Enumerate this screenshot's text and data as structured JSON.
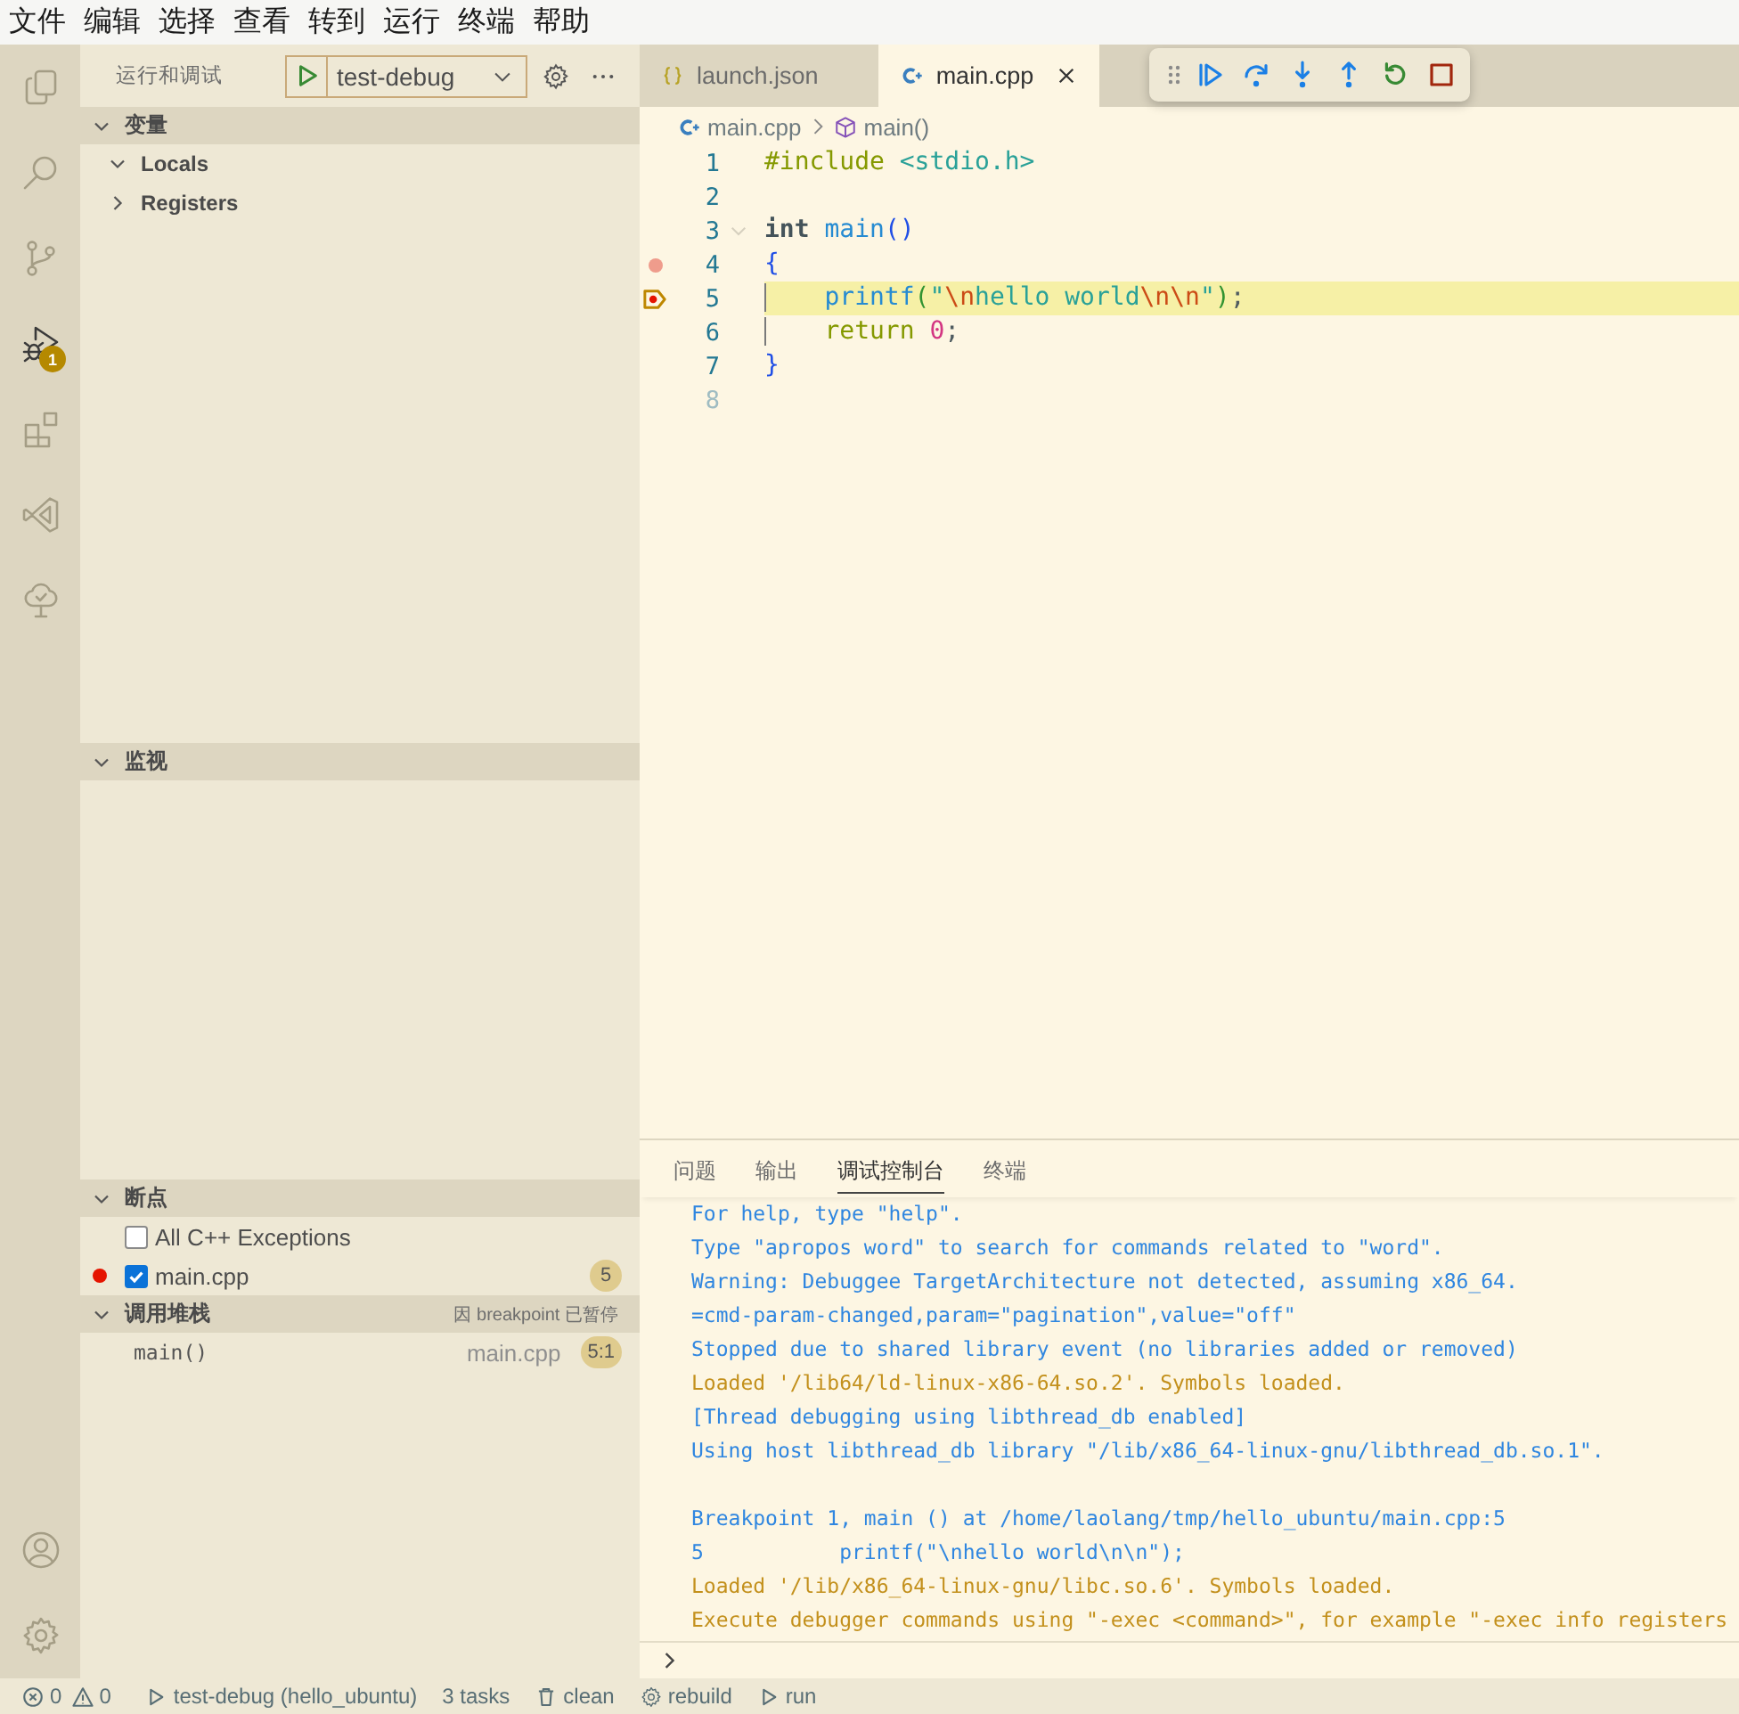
{
  "menu_bar": {
    "items": [
      "文件",
      "编辑",
      "选择",
      "查看",
      "转到",
      "运行",
      "终端",
      "帮助"
    ]
  },
  "activity_bar": {
    "items": [
      {
        "selected": false
      },
      {
        "selected": false
      },
      {
        "selected": false
      },
      {
        "selected": true,
        "badge": "1"
      },
      {
        "selected": false
      },
      {
        "selected": false
      },
      {
        "selected": false
      }
    ]
  },
  "sidebar": {
    "title": "运行和调试",
    "configuration": "test-debug",
    "variables": {
      "title": "变量",
      "expanded": true,
      "items": [
        {
          "label": "Locals",
          "expanded": true
        },
        {
          "label": "Registers",
          "expanded": false
        }
      ]
    },
    "watch": {
      "title": "监视",
      "expanded": true
    },
    "breakpoints": {
      "title": "断点",
      "expanded": true,
      "items": [
        {
          "kind": "exception",
          "label": "All C++ Exceptions",
          "checked": false
        },
        {
          "kind": "source",
          "label": "main.cpp",
          "checked": true,
          "line": "5"
        }
      ]
    },
    "call_stack": {
      "title": "调用堆栈",
      "expanded": true,
      "status": "因 breakpoint 已暂停",
      "frames": [
        {
          "name": "main()",
          "file": "main.cpp",
          "position": "5:1"
        }
      ]
    }
  },
  "editor": {
    "tabs": [
      {
        "kind": "json",
        "label": "launch.json",
        "selected": false
      },
      {
        "kind": "cpp",
        "label": "main.cpp",
        "selected": true
      }
    ],
    "breadcrumbs": [
      "main.cpp",
      "main()"
    ],
    "lines": [
      {
        "number": "1",
        "dimmed": false,
        "foldable": false,
        "current": false,
        "breakpoint_hint": false,
        "paused": false,
        "tokens": [
          {
            "kind": "directive",
            "text": "#include "
          },
          {
            "kind": "header",
            "text": "<stdio.h>"
          }
        ]
      },
      {
        "number": "2",
        "dimmed": false,
        "foldable": false,
        "current": false,
        "breakpoint_hint": false,
        "paused": false
      },
      {
        "number": "3",
        "dimmed": false,
        "foldable": true,
        "current": false,
        "breakpoint_hint": false,
        "paused": false,
        "tokens": [
          {
            "kind": "type",
            "text": "int "
          },
          {
            "kind": "function",
            "text": "main"
          },
          {
            "kind": "bracket1",
            "text": "()"
          }
        ]
      },
      {
        "number": "4",
        "dimmed": false,
        "foldable": false,
        "current": false,
        "breakpoint_hint": true,
        "paused": false,
        "tokens": [
          {
            "kind": "bracket1",
            "text": "{"
          }
        ]
      },
      {
        "number": "5",
        "dimmed": false,
        "foldable": false,
        "current": true,
        "breakpoint_hint": false,
        "paused": true,
        "tokens": [
          {
            "kind": "function",
            "text": "    printf"
          },
          {
            "kind": "bracket2",
            "text": "("
          },
          {
            "kind": "string",
            "text": "\""
          },
          {
            "kind": "escape",
            "text": "\\n"
          },
          {
            "kind": "string",
            "text": "hello world"
          },
          {
            "kind": "escape",
            "text": "\\n\\n"
          },
          {
            "kind": "string",
            "text": "\""
          },
          {
            "kind": "bracket2",
            "text": ")"
          },
          {
            "kind": "plain",
            "text": ";"
          }
        ]
      },
      {
        "number": "6",
        "dimmed": false,
        "foldable": false,
        "current": false,
        "breakpoint_hint": false,
        "paused": false,
        "tokens": [
          {
            "kind": "control",
            "text": "    return "
          },
          {
            "kind": "number",
            "text": "0"
          },
          {
            "kind": "plain",
            "text": ";"
          }
        ]
      },
      {
        "number": "7",
        "dimmed": false,
        "foldable": false,
        "current": false,
        "breakpoint_hint": false,
        "paused": false,
        "tokens": [
          {
            "kind": "bracket1",
            "text": "}"
          }
        ]
      },
      {
        "number": "8",
        "dimmed": true,
        "foldable": false,
        "current": false,
        "breakpoint_hint": false,
        "paused": false
      }
    ]
  },
  "panel": {
    "tabs": [
      {
        "label": "问题",
        "selected": false
      },
      {
        "label": "输出",
        "selected": false
      },
      {
        "label": "调试控制台",
        "selected": true
      },
      {
        "label": "终端",
        "selected": false
      }
    ],
    "console": [
      {
        "kind": "output",
        "text": "For help, type \"help\"."
      },
      {
        "kind": "output",
        "text": "Type \"apropos word\" to search for commands related to \"word\"."
      },
      {
        "kind": "output",
        "text": "Warning: Debuggee TargetArchitecture not detected, assuming x86_64."
      },
      {
        "kind": "output",
        "text": "=cmd-param-changed,param=\"pagination\",value=\"off\""
      },
      {
        "kind": "output",
        "text": "Stopped due to shared library event (no libraries added or removed)"
      },
      {
        "kind": "notice",
        "text": "Loaded '/lib64/ld-linux-x86-64.so.2'. Symbols loaded."
      },
      {
        "kind": "output",
        "text": "[Thread debugging using libthread_db enabled]"
      },
      {
        "kind": "output",
        "text": "Using host libthread_db library \"/lib/x86_64-linux-gnu/libthread_db.so.1\"."
      },
      {
        "kind": "spacer"
      },
      {
        "kind": "output",
        "text": "Breakpoint 1, main () at /home/laolang/tmp/hello_ubuntu/main.cpp:5"
      },
      {
        "kind": "output",
        "text": "5           printf(\"\\nhello world\\n\\n\");"
      },
      {
        "kind": "notice",
        "text": "Loaded '/lib/x86_64-linux-gnu/libc.so.6'. Symbols loaded."
      },
      {
        "kind": "notice",
        "text": "Execute debugger commands using \"-exec <command>\", for example \"-exec info registers"
      }
    ]
  },
  "status_bar": {
    "errors": "0",
    "warnings": "0",
    "items": [
      "test-debug (hello_ubuntu)",
      "3 tasks",
      "clean",
      "rebuild",
      "run"
    ]
  }
}
